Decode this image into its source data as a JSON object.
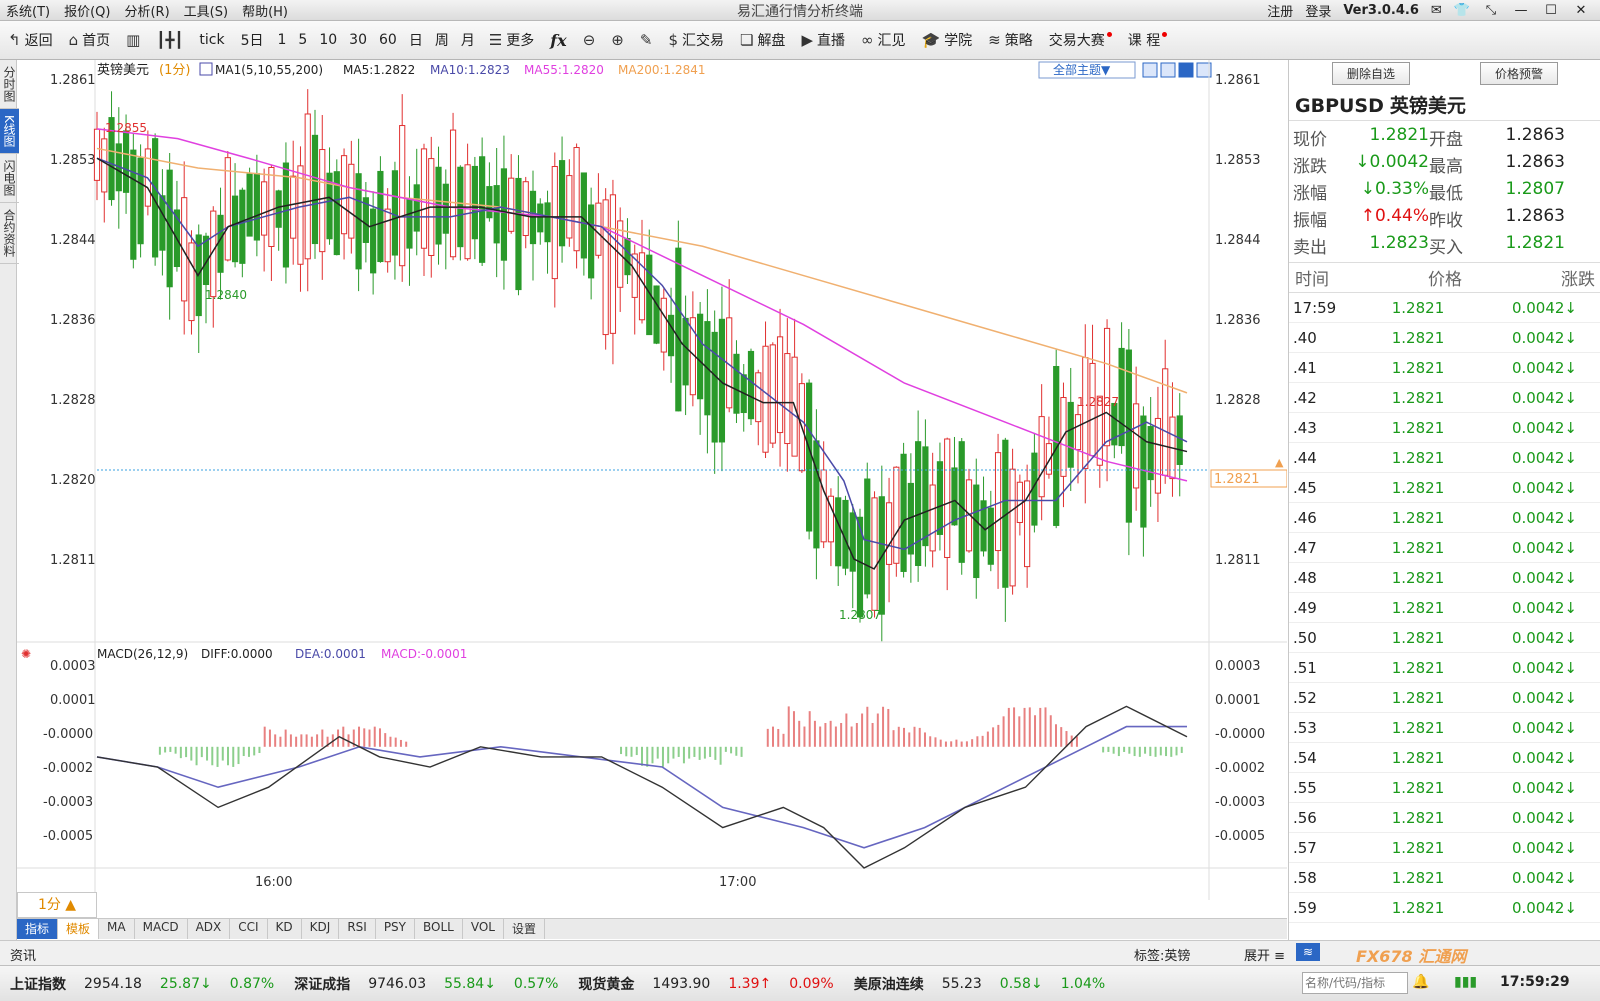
{
  "titlebar": {
    "menus": [
      "系统(T)",
      "报价(Q)",
      "分析(R)",
      "工具(S)",
      "帮助(H)"
    ],
    "title": "易汇通行情分析终端",
    "register": "注册",
    "login": "登录",
    "version": "Ver3.0.4.6"
  },
  "toolbar": {
    "back": "返回",
    "home": "首页",
    "tick": "tick",
    "fiveday": "5日",
    "periods": [
      "1",
      "5",
      "10",
      "30",
      "60",
      "日",
      "周",
      "月"
    ],
    "more": "更多",
    "fx": "fx",
    "draw": "✎",
    "trade": "汇交易",
    "analysis": "解盘",
    "live": "直播",
    "huijian": "汇见",
    "school": "学院",
    "strategy": "策略",
    "contest": "交易大赛",
    "course": "课 程"
  },
  "left_tabs": [
    "分时图",
    "K线图",
    "闪电图",
    "合约资料"
  ],
  "chart": {
    "symbol_label": "英镑美元",
    "period_label": "(1分)",
    "ma_label": "MA1(5,10,55,200)",
    "ma5": "MA5:1.2822",
    "ma10": "MA10:1.2823",
    "ma55": "MA55:1.2820",
    "ma200": "MA200:1.2841",
    "theme_btn": "全部主题▼",
    "price_ticks": [
      "1.2861",
      "1.2853",
      "1.2844",
      "1.2836",
      "1.2828",
      "1.2820",
      "1.2811"
    ],
    "current_price": "1.2821",
    "annot_high1": "1.2855",
    "annot_low1": "1.2840",
    "annot_low2": "1.2807",
    "annot_high2": "1.2827",
    "time_labels": [
      "16:00",
      "17:00"
    ],
    "macd_label": "MACD(26,12,9)",
    "diff": "DIFF:0.0000",
    "dea": "DEA:0.0001",
    "macd": "MACD:-0.0001",
    "macd_ticks": [
      "0.0003",
      "0.0001",
      "-0.0000",
      "-0.0002",
      "-0.0003",
      "-0.0005"
    ],
    "colors": {
      "up": "#e03030",
      "down": "#2a9a2a",
      "ma5": "#222222",
      "ma10": "#4a4aa8",
      "ma55": "#e040e0",
      "ma200": "#f0b070"
    }
  },
  "chart_data": {
    "type": "candlestick",
    "price_axis": [
      1.2807,
      1.2861
    ],
    "ma200": [
      [
        0,
        1.2854
      ],
      [
        100,
        1.2852
      ],
      [
        200,
        1.2851
      ],
      [
        300,
        1.2849
      ],
      [
        400,
        1.2848
      ],
      [
        500,
        1.2846
      ],
      [
        600,
        1.2844
      ],
      [
        700,
        1.2841
      ],
      [
        800,
        1.2838
      ],
      [
        900,
        1.2835
      ],
      [
        1000,
        1.2832
      ],
      [
        1080,
        1.2829
      ]
    ],
    "ma55": [
      [
        0,
        1.2856
      ],
      [
        80,
        1.2855
      ],
      [
        150,
        1.2853
      ],
      [
        250,
        1.285
      ],
      [
        350,
        1.2848
      ],
      [
        450,
        1.2847
      ],
      [
        500,
        1.2846
      ],
      [
        600,
        1.2841
      ],
      [
        700,
        1.2836
      ],
      [
        800,
        1.283
      ],
      [
        900,
        1.2826
      ],
      [
        950,
        1.2824
      ],
      [
        1000,
        1.2822
      ],
      [
        1080,
        1.282
      ]
    ],
    "ma10": [
      [
        0,
        1.2853
      ],
      [
        50,
        1.2851
      ],
      [
        100,
        1.2844
      ],
      [
        130,
        1.2846
      ],
      [
        200,
        1.2848
      ],
      [
        250,
        1.2849
      ],
      [
        300,
        1.2847
      ],
      [
        350,
        1.2847
      ],
      [
        400,
        1.2848
      ],
      [
        450,
        1.2847
      ],
      [
        500,
        1.2846
      ],
      [
        560,
        1.284
      ],
      [
        600,
        1.2834
      ],
      [
        650,
        1.283
      ],
      [
        700,
        1.2826
      ],
      [
        740,
        1.282
      ],
      [
        760,
        1.2814
      ],
      [
        800,
        1.2813
      ],
      [
        850,
        1.2816
      ],
      [
        900,
        1.2818
      ],
      [
        950,
        1.2818
      ],
      [
        1000,
        1.2824
      ],
      [
        1040,
        1.2826
      ],
      [
        1080,
        1.2824
      ]
    ],
    "ma5": [
      [
        0,
        1.2853
      ],
      [
        50,
        1.285
      ],
      [
        100,
        1.2841
      ],
      [
        130,
        1.2846
      ],
      [
        180,
        1.2848
      ],
      [
        230,
        1.2849
      ],
      [
        270,
        1.2846
      ],
      [
        330,
        1.2848
      ],
      [
        380,
        1.2848
      ],
      [
        430,
        1.2847
      ],
      [
        480,
        1.2847
      ],
      [
        530,
        1.2842
      ],
      [
        580,
        1.2834
      ],
      [
        620,
        1.283
      ],
      [
        660,
        1.2828
      ],
      [
        690,
        1.2828
      ],
      [
        720,
        1.2819
      ],
      [
        750,
        1.2812
      ],
      [
        770,
        1.2811
      ],
      [
        800,
        1.2816
      ],
      [
        850,
        1.2818
      ],
      [
        880,
        1.2815
      ],
      [
        920,
        1.2818
      ],
      [
        960,
        1.2825
      ],
      [
        1000,
        1.2827
      ],
      [
        1040,
        1.2824
      ],
      [
        1080,
        1.2823
      ]
    ],
    "macd_axis": [
      -0.0006,
      0.0004
    ],
    "diff": [
      [
        0,
        -5e-05
      ],
      [
        60,
        -0.0001
      ],
      [
        120,
        -0.0003
      ],
      [
        170,
        -0.0002
      ],
      [
        240,
        5e-05
      ],
      [
        280,
        -5e-05
      ],
      [
        330,
        -0.0001
      ],
      [
        380,
        0.0
      ],
      [
        440,
        -5e-05
      ],
      [
        500,
        -5e-05
      ],
      [
        560,
        -0.0002
      ],
      [
        620,
        -0.0004
      ],
      [
        680,
        -0.0003
      ],
      [
        720,
        -0.0004
      ],
      [
        760,
        -0.0006
      ],
      [
        800,
        -0.0005
      ],
      [
        860,
        -0.0003
      ],
      [
        920,
        -0.0002
      ],
      [
        980,
        0.0001
      ],
      [
        1020,
        0.0002
      ],
      [
        1080,
        5e-05
      ]
    ],
    "dea": [
      [
        0,
        -5e-05
      ],
      [
        60,
        -0.0001
      ],
      [
        120,
        -0.0002
      ],
      [
        200,
        -0.0001
      ],
      [
        260,
        0.0
      ],
      [
        320,
        -5e-05
      ],
      [
        400,
        0.0
      ],
      [
        480,
        -5e-05
      ],
      [
        560,
        -0.0001
      ],
      [
        620,
        -0.0003
      ],
      [
        700,
        -0.0004
      ],
      [
        760,
        -0.0005
      ],
      [
        820,
        -0.0004
      ],
      [
        900,
        -0.0002
      ],
      [
        980,
        0.0
      ],
      [
        1020,
        0.0001
      ],
      [
        1080,
        0.0001
      ]
    ],
    "hist": [
      0,
      0,
      0,
      -5e-05,
      -0.0001,
      -0.0001,
      -0.0001,
      -5e-05,
      0.0001,
      0.0001,
      0.0001,
      0.0001,
      0.0001,
      0.0001,
      5e-05,
      0,
      0,
      0,
      0,
      0,
      0,
      0,
      0,
      0,
      0,
      -5e-05,
      -0.0001,
      -0.0001,
      -0.0001,
      -0.0001,
      -5e-05,
      0,
      0.0001,
      0.0002,
      0.0002,
      0.0002,
      0.0002,
      0.0002,
      0.0001,
      0.0001,
      5e-05,
      5e-05,
      0.0001,
      0.0002,
      0.0002,
      0.0002,
      0.0001,
      0,
      -5e-05,
      -5e-05,
      -5e-05,
      -5e-05
    ]
  },
  "right_panel": {
    "btn_delete": "删除自选",
    "btn_alert": "价格预警",
    "symbol": "GBPUSD",
    "symbol_cn": "英镑美元",
    "quote": [
      {
        "l": "现价",
        "v": "1.2821",
        "c": "green",
        "l2": "开盘",
        "v2": "1.2863",
        "c2": ""
      },
      {
        "l": "涨跌",
        "v": "↓0.0042",
        "c": "green",
        "l2": "最高",
        "v2": "1.2863",
        "c2": ""
      },
      {
        "l": "涨幅",
        "v": "↓0.33%",
        "c": "green",
        "l2": "最低",
        "v2": "1.2807",
        "c2": "green"
      },
      {
        "l": "振幅",
        "v": "↑0.44%",
        "c": "red",
        "l2": "昨收",
        "v2": "1.2863",
        "c2": ""
      },
      {
        "l": "卖出",
        "v": "1.2823",
        "c": "green",
        "l2": "买入",
        "v2": "1.2821",
        "c2": "green"
      }
    ],
    "th": [
      "时间",
      "价格",
      "涨跌"
    ],
    "ticks": [
      {
        "t": "17:59",
        "p": "1.2821",
        "c": "0.0042↓"
      },
      {
        "t": ".40",
        "p": "1.2821",
        "c": "0.0042↓"
      },
      {
        "t": ".41",
        "p": "1.2821",
        "c": "0.0042↓"
      },
      {
        "t": ".42",
        "p": "1.2821",
        "c": "0.0042↓"
      },
      {
        "t": ".43",
        "p": "1.2821",
        "c": "0.0042↓"
      },
      {
        "t": ".44",
        "p": "1.2821",
        "c": "0.0042↓"
      },
      {
        "t": ".45",
        "p": "1.2821",
        "c": "0.0042↓"
      },
      {
        "t": ".46",
        "p": "1.2821",
        "c": "0.0042↓"
      },
      {
        "t": ".47",
        "p": "1.2821",
        "c": "0.0042↓"
      },
      {
        "t": ".48",
        "p": "1.2821",
        "c": "0.0042↓"
      },
      {
        "t": ".49",
        "p": "1.2821",
        "c": "0.0042↓"
      },
      {
        "t": ".50",
        "p": "1.2821",
        "c": "0.0042↓"
      },
      {
        "t": ".51",
        "p": "1.2821",
        "c": "0.0042↓"
      },
      {
        "t": ".52",
        "p": "1.2821",
        "c": "0.0042↓"
      },
      {
        "t": ".53",
        "p": "1.2821",
        "c": "0.0042↓"
      },
      {
        "t": ".54",
        "p": "1.2821",
        "c": "0.0042↓"
      },
      {
        "t": ".55",
        "p": "1.2821",
        "c": "0.0042↓"
      },
      {
        "t": ".56",
        "p": "1.2821",
        "c": "0.0042↓"
      },
      {
        "t": ".57",
        "p": "1.2821",
        "c": "0.0042↓"
      },
      {
        "t": ".58",
        "p": "1.2821",
        "c": "0.0042↓"
      },
      {
        "t": ".59",
        "p": "1.2821",
        "c": "0.0042↓"
      }
    ]
  },
  "bottom": {
    "period": "1分 ▲",
    "ind_tabs": [
      "指标",
      "模板",
      "MA",
      "MACD",
      "ADX",
      "CCI",
      "KD",
      "KDJ",
      "RSI",
      "PSY",
      "BOLL",
      "VOL",
      "设置"
    ],
    "news": "资讯",
    "tag": "标签:英镑",
    "expand": "展开 ≡",
    "search_ph": "名称/代码/指标",
    "logo": "FX678 汇通网",
    "ticker": [
      {
        "n": "上证指数",
        "v": "2954.18",
        "c": "25.87↓",
        "p": "0.87%",
        "col": "green"
      },
      {
        "n": "深证成指",
        "v": "9746.03",
        "c": "55.84↓",
        "p": "0.57%",
        "col": "green"
      },
      {
        "n": "现货黄金",
        "v": "1493.90",
        "c": "1.39↑",
        "p": "0.09%",
        "col": "red"
      },
      {
        "n": "美原油连续",
        "v": "55.23",
        "c": "0.58↓",
        "p": "1.04%",
        "col": "green"
      }
    ],
    "clock": "17:59:29"
  }
}
